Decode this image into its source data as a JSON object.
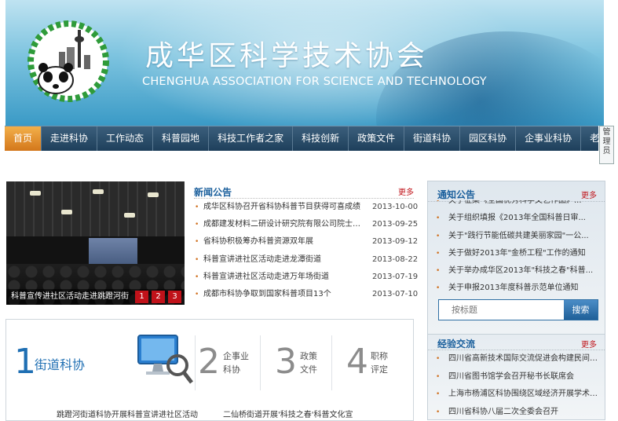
{
  "header": {
    "title": "成华区科学技术协会",
    "subtitle": "CHENGHUA ASSOCIATION FOR SCIENCE AND TECHNOLOGY"
  },
  "nav": {
    "items": [
      {
        "label": "首页",
        "active": true
      },
      {
        "label": "走进科协"
      },
      {
        "label": "工作动态"
      },
      {
        "label": "科普园地"
      },
      {
        "label": "科技工作者之家"
      },
      {
        "label": "科技创新"
      },
      {
        "label": "政策文件"
      },
      {
        "label": "街道科协"
      },
      {
        "label": "园区科协"
      },
      {
        "label": "企事业科协"
      },
      {
        "label": "老科协"
      }
    ],
    "admin_tab": "管理员"
  },
  "slider": {
    "caption": "科普宣传进社区活动走进跳蹬河街",
    "dots": [
      "1",
      "2",
      "3"
    ]
  },
  "news": {
    "title": "新闻公告",
    "more": "更多",
    "items": [
      {
        "text": "成华区科协召开省科协科普节目获得可喜成绩",
        "date": "2013-10-00"
      },
      {
        "text": "成都建发材料二研设计研究院有限公司院士（...",
        "date": "2013-09-25"
      },
      {
        "text": "省科协积极筹办科普资源双年展",
        "date": "2013-09-12"
      },
      {
        "text": "科普宣讲进社区活动走进龙潭街道",
        "date": "2013-08-22"
      },
      {
        "text": "科普宣讲进社区活动走进万年场街道",
        "date": "2013-07-19"
      },
      {
        "text": "成都市科协争取到国家科普项目13个",
        "date": "2013-07-10"
      }
    ]
  },
  "features": {
    "f1_num": "1",
    "f1_label": "街道科协",
    "f2_num": "2",
    "f2_l1": "企事业",
    "f2_l2": "科协",
    "f3_num": "3",
    "f3_l1": "政策",
    "f3_l2": "文件",
    "f4_num": "4",
    "f4_l1": "职称",
    "f4_l2": "评定",
    "link1": "跳蹬河街道科协开展科普宣讲进社区活动",
    "link2": "二仙桥街道开展'科技之春'科普文化宣"
  },
  "notices": {
    "title": "通知公告",
    "more": "更多",
    "items": [
      "关于征集《全国优秀科学文艺作品》...",
      "关于组织填报《2013年全国科普日审...",
      "关于\"践行节能低碳共建美丽家园\"一公...",
      "关于做好2013年\"金桥工程\"工作的通知",
      "关于举办成华区2013年\"科技之春\"科普...",
      "关于申报2013年度科普示范单位通知"
    ]
  },
  "search": {
    "placeholder": "按标题",
    "button": "搜索"
  },
  "exchange": {
    "title": "经验交流",
    "more": "更多",
    "items": [
      "四川省高新技术国际交流促进会构建民间国际...",
      "四川省图书馆学会召开秘书长联席会",
      "上海市杨浦区科协围绕区域经济开展学术交流",
      "四川省科协八届二次全委会召开"
    ]
  }
}
